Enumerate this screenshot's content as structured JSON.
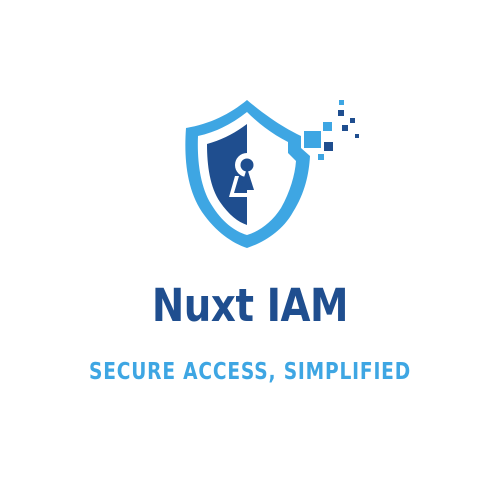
{
  "brand": {
    "name": "Nuxt IAM",
    "tagline": "SECURE ACCESS, SIMPLIFIED"
  },
  "colors": {
    "background": "#ffffff",
    "navy": "#1f4e8f",
    "sky_blue": "#3ea6e3"
  },
  "icons": {
    "emblem": "shield-keyhole-icon"
  }
}
